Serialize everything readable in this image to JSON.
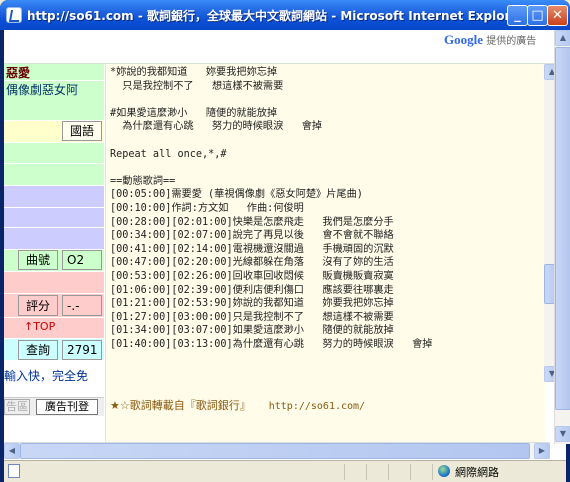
{
  "window": {
    "title": "http://so61.com - 歌詞銀行，全球最大中文歌詞網站 - Microsoft Internet Explorer",
    "minimize": "_",
    "maximize": "□",
    "close": "✕"
  },
  "ads": {
    "google_brand": "Google",
    "google_sub": "提供的廣告"
  },
  "left_panel": {
    "song_title": "惡愛",
    "series": "偶像劇惡女阿",
    "language": "國語",
    "track_label": "曲號",
    "track_value": "O2",
    "rating_label": "評分",
    "rating_value": "-.-",
    "top_link": "↑TOP",
    "query_label": "查詢",
    "query_value": "2791",
    "promo": "輸入快，完全免",
    "area_btn": "告區",
    "ad_btn": "廣告刊登"
  },
  "lyrics": {
    "lines": [
      "*妳說的我都知道   妳要我把妳忘掉",
      "  只是我控制不了   想這樣不被需要",
      "",
      "#如果愛這麼渺小   隨便的就能放掉",
      "  為什麼還有心跳   努力的時候眼淚   會掉",
      "",
      "Repeat all once,*,#",
      "",
      "==動態歌詞==",
      "[00:05:00]需要愛 (華視偶像劇《惡女阿楚》片尾曲)",
      "[00:10:00]作詞:方文如   作曲:何俊明",
      "[00:28:00][02:01:00]快樂是怎麼飛走   我們是怎麼分手",
      "[00:34:00][02:07:00]說完了再見以後   會不會就不聯絡",
      "[00:41:00][02:14:00]電視機還沒關過   手機頑固的沉默",
      "[00:47:00][02:20:00]光線都躲在角落   沒有了妳的生活",
      "[00:53:00][02:26:00]回收車回收悶候   販賣機販賣寂寞",
      "[01:06:00][02:39:00]便利店便利傷口   應該要往哪裏走",
      "[01:21:00][02:53:90]妳說的我都知道   妳要我把妳忘掉",
      "[01:27:00][03:00:00]只是我控制不了   想這樣不被需要",
      "[01:34:00][03:07:00]如果愛這麼渺小   隨便的就能放掉",
      "[01:40:00][03:13:00]為什麼還有心跳   努力的時候眼淚   會掉"
    ],
    "footer_text": "★☆歌詞轉載自『歌詞銀行』",
    "footer_url": "http://so61.com/"
  },
  "statusbar": {
    "zone": "網際網路"
  },
  "colors": {
    "green_cell": "#ccffcc",
    "lavender_cell": "#ccccff",
    "yellow_cell": "#ffffcc",
    "pink_cell": "#ffcccc",
    "cyan_cell": "#ccffff",
    "content_bg": "#fffce9"
  }
}
